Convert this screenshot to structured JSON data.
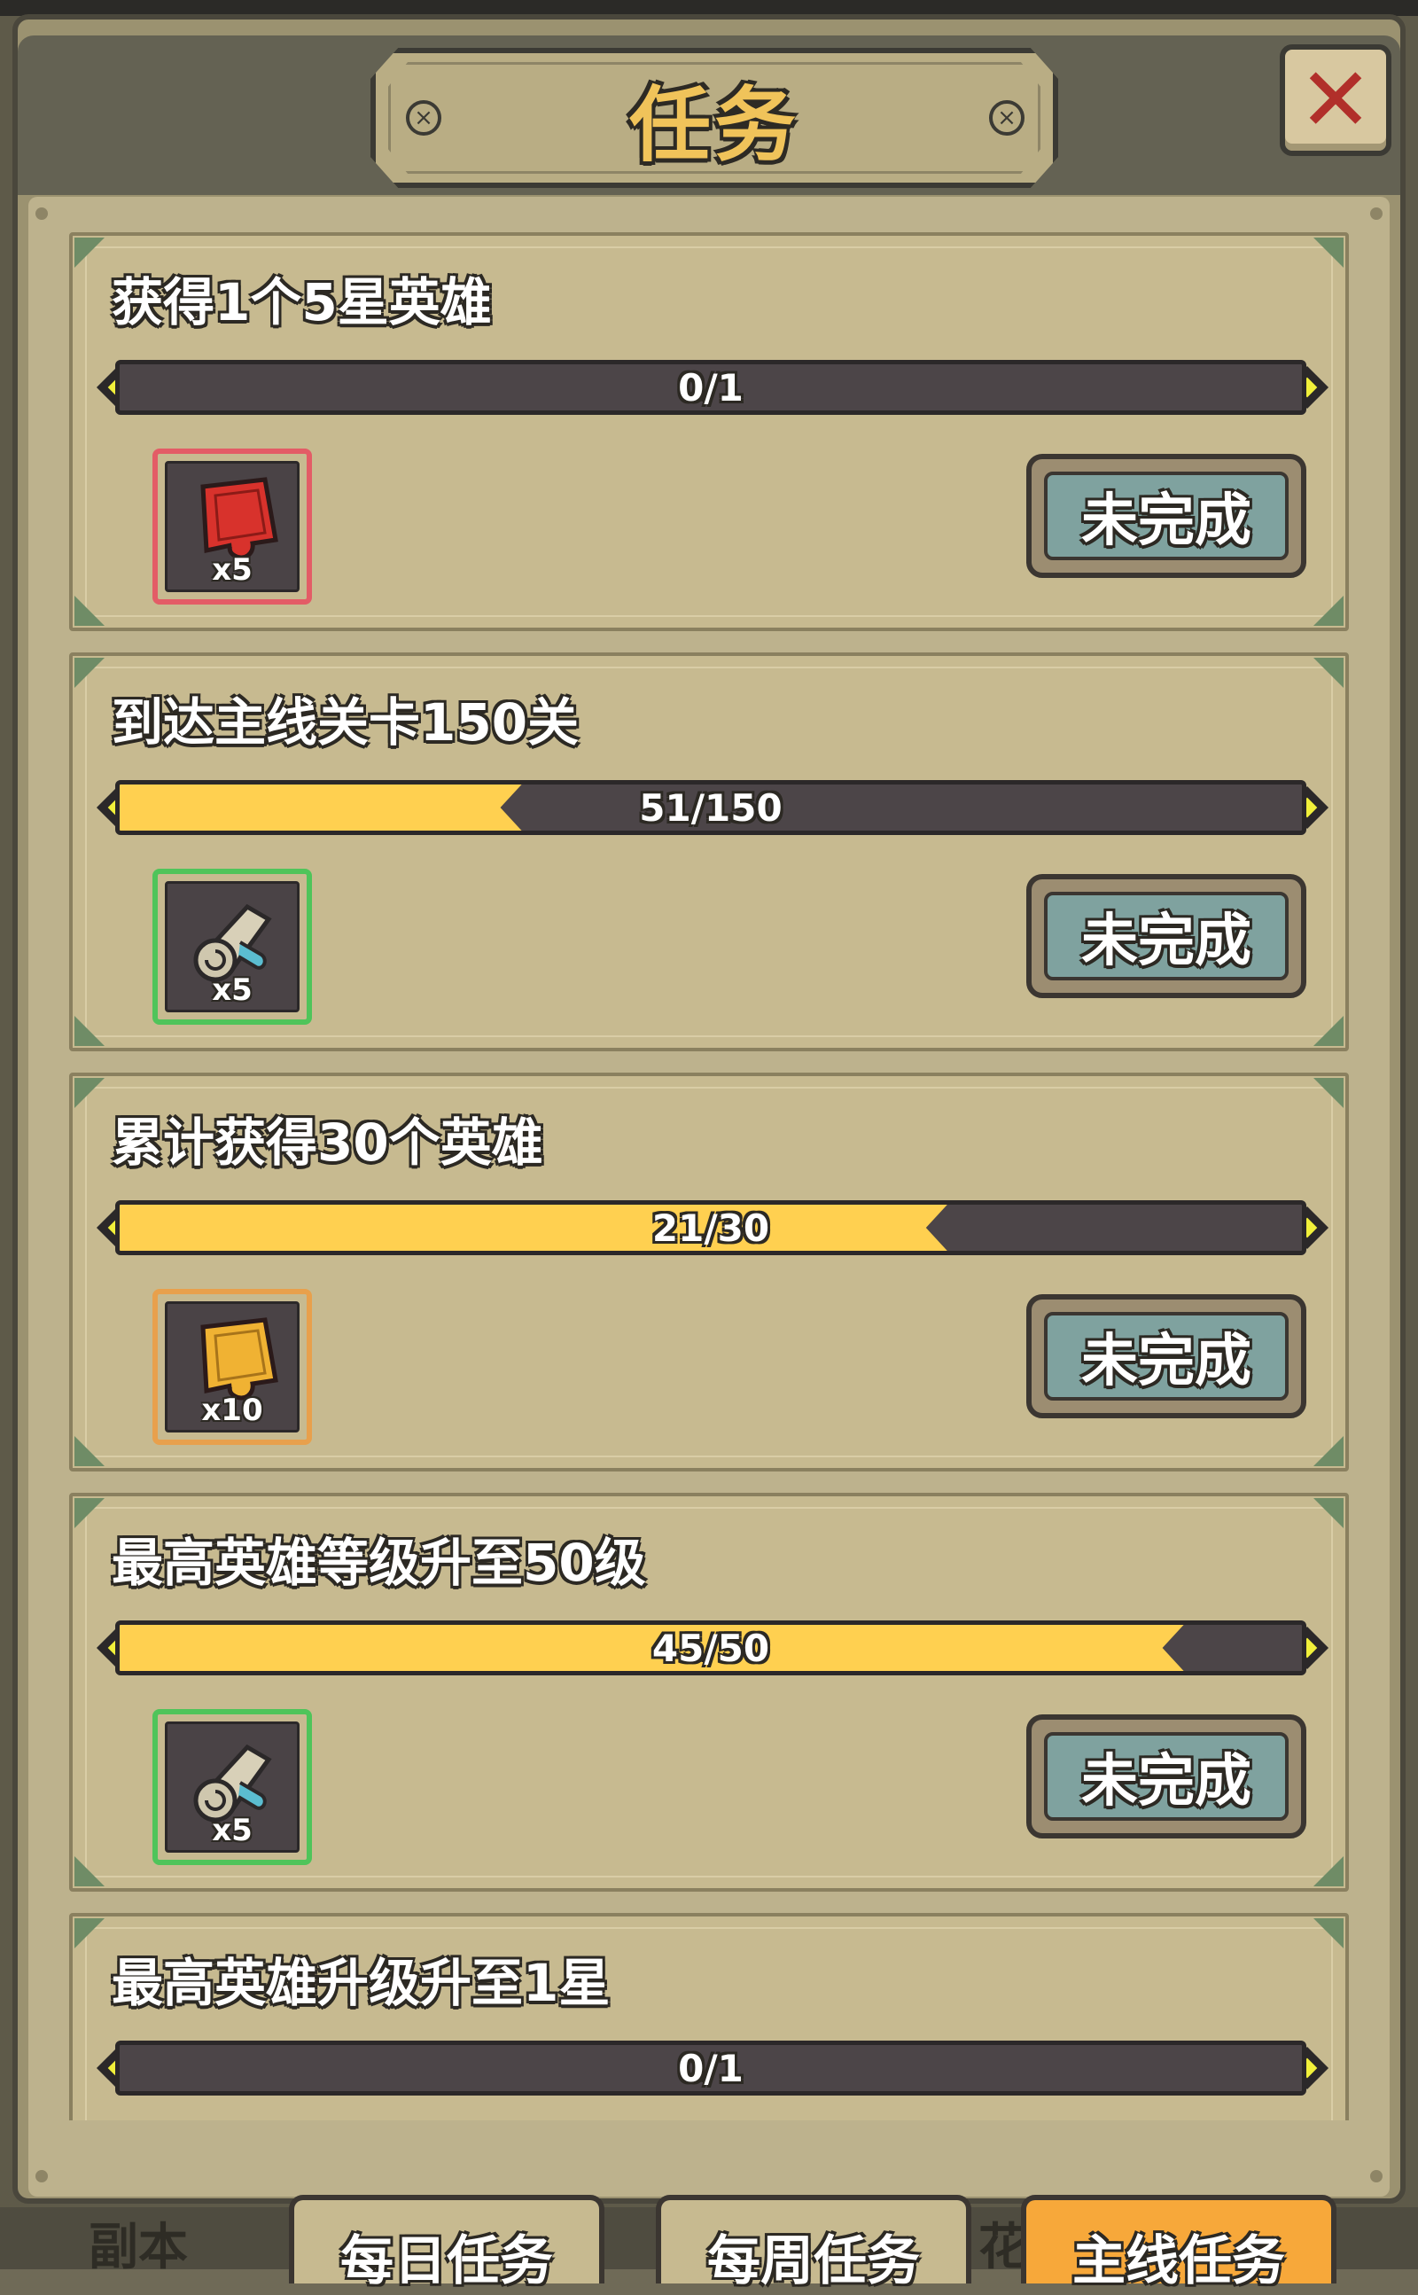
{
  "window": {
    "title": "任务",
    "close_label": "✕"
  },
  "tasks": [
    {
      "title": "获得1个5星英雄",
      "progress_text": "0/1",
      "progress": 0.0,
      "reward": {
        "icon": "red-puzzle-piece-icon",
        "count": "x5",
        "border_color": "#e35c66"
      },
      "status": "未完成"
    },
    {
      "title": "到达主线关卡150关",
      "progress_text": "51/150",
      "progress": 0.34,
      "reward": {
        "icon": "scroll-icon",
        "count": "x5",
        "border_color": "#4fc45a"
      },
      "status": "未完成"
    },
    {
      "title": "累计获得30个英雄",
      "progress_text": "21/30",
      "progress": 0.7,
      "reward": {
        "icon": "gold-puzzle-piece-icon",
        "count": "x10",
        "border_color": "#e8a04c"
      },
      "status": "未完成"
    },
    {
      "title": "最高英雄等级升至50级",
      "progress_text": "45/50",
      "progress": 0.9,
      "reward": {
        "icon": "scroll-icon",
        "count": "x5",
        "border_color": "#4fc45a"
      },
      "status": "未完成"
    },
    {
      "title": "最高英雄升级升至1星",
      "progress_text": "0/1",
      "progress": 0.0,
      "reward": null,
      "status": null
    }
  ],
  "bottom_tabs": {
    "left_partial": "副本",
    "daily": "每日任务",
    "weekly": "每周任务",
    "middle_partial": "花",
    "main": "主线任务"
  },
  "colors": {
    "progress_fill": "#ffd050",
    "status_button": "#7fa29f",
    "active_tab": "#f7a83a"
  }
}
